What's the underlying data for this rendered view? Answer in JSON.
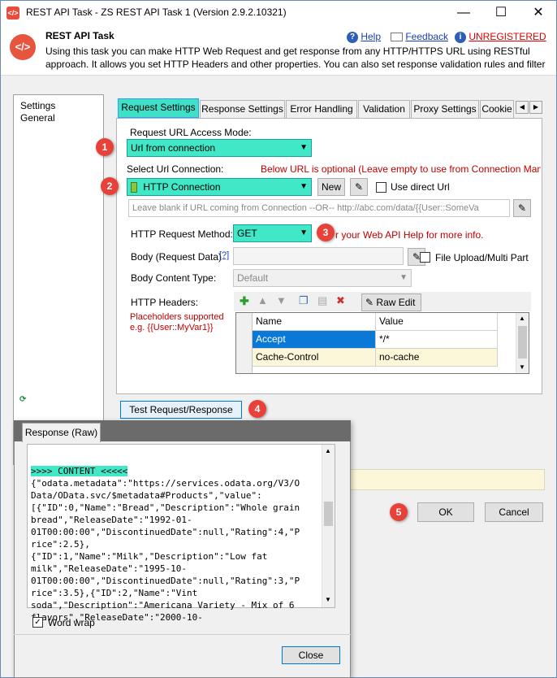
{
  "window": {
    "title": "REST API Task - ZS REST API Task 1 (Version 2.9.2.10321)",
    "minimize": "—",
    "maximize": "☐",
    "close": "✕"
  },
  "header": {
    "icon_text": "</>",
    "title": "REST API Task",
    "description": "Using this task you can make HTTP Web Request and get response from any HTTP/HTTPS URL using RESTful approach. It allows you set HTTP Headers and other properties. You can also set response validation rules and filter",
    "help": "Help",
    "feedback": "Feedback",
    "unregistered": "UNREGISTERED"
  },
  "sidebar": {
    "items": [
      "Settings",
      "General"
    ]
  },
  "tabs": [
    "Request Settings",
    "Response Settings",
    "Error Handling",
    "Validation",
    "Proxy Settings",
    "Cookie"
  ],
  "request": {
    "access_mode_label": "Request URL Access Mode:",
    "access_mode_value": "Url from connection",
    "select_conn_label": "Select Url Connection:",
    "optional_note": "Below URL is optional (Leave empty to use from Connection Man",
    "connection_value": "HTTP Connection",
    "new_button": "New",
    "use_direct_url": "Use direct Url",
    "url_placeholder": "Leave blank if URL coming from Connection --OR-- http://abc.com/data/{{User::SomeVa",
    "method_label": "HTTP Request Method:",
    "method_value": "GET",
    "method_note": "r your Web API Help for more info.",
    "body_label": "Body (Request Data)",
    "body_help": "[?]",
    "file_upload": "File Upload/Multi Part",
    "content_type_label": "Body Content Type:",
    "content_type_value": "Default",
    "headers_label": "HTTP Headers:",
    "placeholders_line1": "Placeholders supported",
    "placeholders_line2": "e.g. {{User::MyVar1}}",
    "raw_edit": "Raw Edit",
    "grid_cols": [
      "Name",
      "Value"
    ],
    "grid_rows": [
      {
        "name": "Accept",
        "value": "*/*"
      },
      {
        "name": "Cache-Control",
        "value": "no-cache"
      }
    ],
    "test_button": "Test Request/Response"
  },
  "callouts": [
    "1",
    "2",
    "3",
    "4",
    "5"
  ],
  "footer": {
    "ok": "OK",
    "cancel": "Cancel"
  },
  "response_dialog": {
    "tab": "Response (Raw)",
    "content_header": ">>>> CONTENT <<<<<",
    "lines": [
      "{\"odata.metadata\":\"https://services.odata.org/V3/O",
      "Data/OData.svc/$metadata#Products\",\"value\":",
      "[{\"ID\":0,\"Name\":\"Bread\",\"Description\":\"Whole grain",
      "bread\",\"ReleaseDate\":\"1992-01-",
      "01T00:00:00\",\"DiscontinuedDate\":null,\"Rating\":4,\"P",
      "rice\":2.5},",
      "{\"ID\":1,\"Name\":\"Milk\",\"Description\":\"Low fat",
      "milk\",\"ReleaseDate\":\"1995-10-",
      "01T00:00:00\",\"DiscontinuedDate\":null,\"Rating\":3,\"P",
      "rice\":3.5},{\"ID\":2,\"Name\":\"Vint",
      "soda\",\"Description\":\"Americana Variety - Mix of 6",
      "flavors\",\"ReleaseDate\":\"2000-10-"
    ],
    "word_wrap": "Word wrap",
    "close": "Close"
  },
  "colors": {
    "highlight": "#40e8c8",
    "callout": "#e8413a",
    "note_red": "#c00000"
  }
}
